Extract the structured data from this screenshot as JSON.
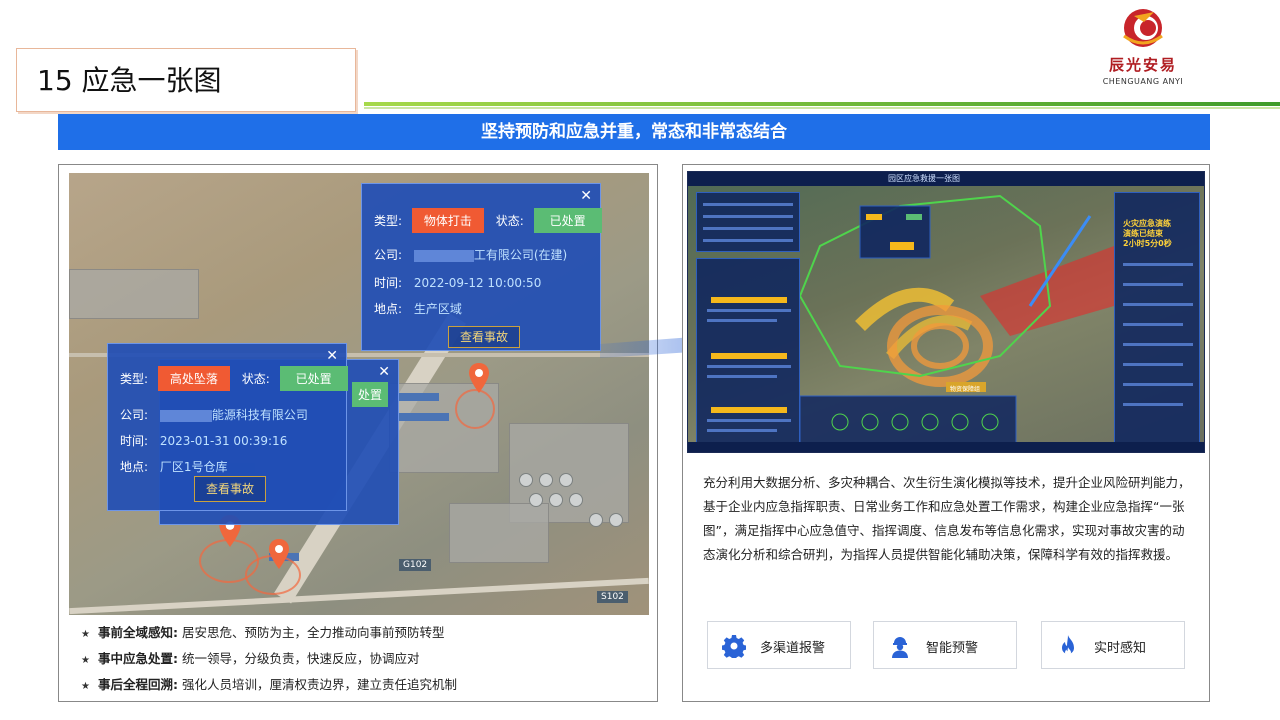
{
  "header": {
    "title": "15 应急一张图",
    "banner": "坚持预防和应急并重，常态和非常态结合"
  },
  "logo": {
    "cn_name": "辰光安易",
    "en_name": "CHENGUANG ANYI"
  },
  "map": {
    "road_labels": [
      "G102",
      "S102"
    ],
    "popup1": {
      "type_label": "类型:",
      "type_value": "物体打击",
      "status_label": "状态:",
      "status_value": "已处置",
      "company_label": "公司:",
      "company_value": "工有限公司(在建)",
      "time_label": "时间:",
      "time_value": "2022-09-12 10:00:50",
      "location_label": "地点:",
      "location_value": "生产区域",
      "view_button": "查看事故"
    },
    "popup2": {
      "type_label": "类型:",
      "type_value": "高处坠落",
      "status_label": "状态:",
      "status_value": "已处置",
      "company_label": "公司:",
      "company_value": "能源科技有限公司",
      "time_label": "时间:",
      "time_value": "2023-01-31 00:39:16",
      "location_label": "地点:",
      "location_value": "厂区1号仓库",
      "view_button": "查看事故"
    },
    "popup_behind": {
      "status_value_partial": "处置"
    }
  },
  "bullets": [
    {
      "title": "事前全域感知:",
      "text": "居安思危、预防为主，全力推动向事前预防转型"
    },
    {
      "title": "事中应急处置:",
      "text": "统一领导，分级负责，快速反应，协调应对"
    },
    {
      "title": "事后全程回溯:",
      "text": "强化人员培训，厘清权责边界，建立责任追究机制"
    }
  ],
  "screen": {
    "title": "园区应急救援一张图",
    "alert_lines": [
      "火灾应急演练",
      "演练已结束",
      "2小时5分0秒"
    ],
    "zone_label": "物资保障组"
  },
  "description": "充分利用大数据分析、多灾种耦合、次生衍生演化模拟等技术，提升企业风险研判能力，基于企业内应急指挥职责、日常业务工作和应急处置工作需求，构建企业应急指挥“一张图”，满足指挥中心应急值守、指挥调度、信息发布等信息化需求，实现对事故灾害的动态演化分析和综合研判，为指挥人员提供智能化辅助决策，保障科学有效的指挥救援。",
  "features": [
    {
      "label": "多渠道报警",
      "icon": "gear-icon"
    },
    {
      "label": "智能预警",
      "icon": "worker-icon"
    },
    {
      "label": "实时感知",
      "icon": "flame-icon"
    }
  ],
  "colors": {
    "banner": "#1f6fe8",
    "accent_blue": "#2a63d6",
    "popup_bg": "#214eb5",
    "tag_red": "#f05a33",
    "tag_green": "#5bbc74",
    "logo_red": "#b01d22"
  }
}
